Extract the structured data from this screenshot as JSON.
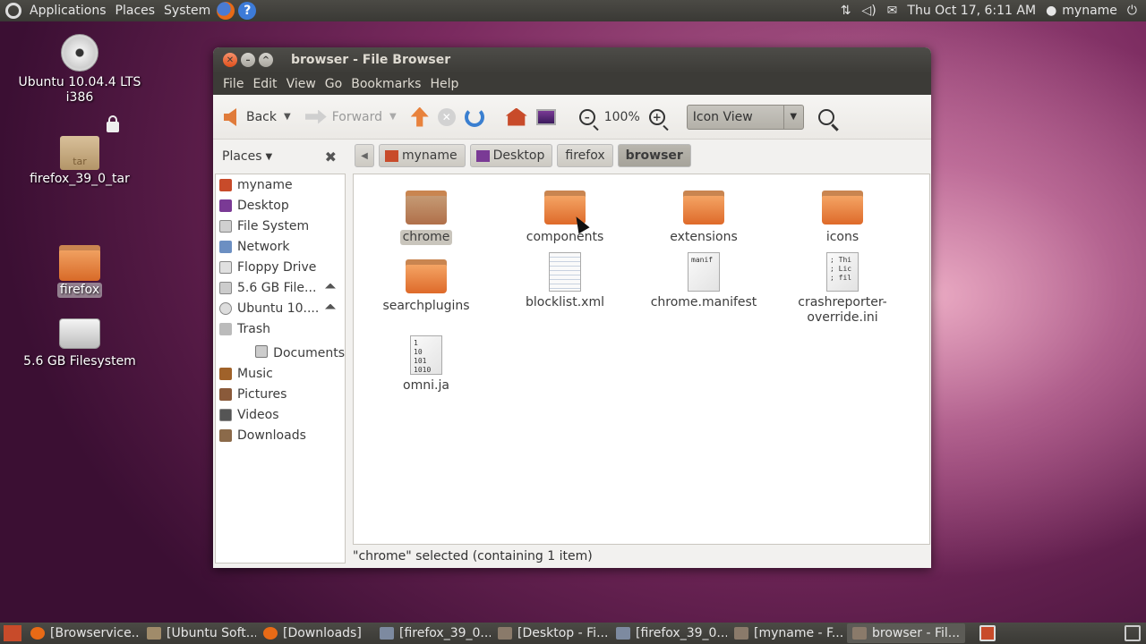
{
  "top_panel": {
    "menus": [
      "Applications",
      "Places",
      "System"
    ],
    "datetime": "Thu Oct 17,  6:11 AM",
    "user": "myname"
  },
  "desktop": {
    "icons": [
      {
        "label_line1": "Ubuntu 10.04.4 LTS",
        "label_line2": "i386"
      },
      {
        "label": "firefox_39_0_tar",
        "badge": "tar"
      },
      {
        "label": "firefox"
      },
      {
        "label": "5.6 GB Filesystem"
      }
    ]
  },
  "window": {
    "title": "browser - File Browser",
    "menu": [
      "File",
      "Edit",
      "View",
      "Go",
      "Bookmarks",
      "Help"
    ],
    "toolbar": {
      "back": "Back",
      "forward": "Forward",
      "zoom": "100%",
      "view_mode": "Icon View"
    },
    "sidebar": {
      "header": "Places",
      "items": [
        "myname",
        "Desktop",
        "File System",
        "Network",
        "Floppy Drive",
        "5.6 GB File...",
        "Ubuntu 10....",
        "Trash",
        "Documents",
        "Music",
        "Pictures",
        "Videos",
        "Downloads"
      ]
    },
    "path": [
      "myname",
      "Desktop",
      "firefox",
      "browser"
    ],
    "files": [
      {
        "name": "chrome",
        "type": "folder",
        "selected": true
      },
      {
        "name": "components",
        "type": "folder"
      },
      {
        "name": "extensions",
        "type": "folder"
      },
      {
        "name": "icons",
        "type": "folder"
      },
      {
        "name": "searchplugins",
        "type": "folder"
      },
      {
        "name": "blocklist.xml",
        "type": "xml"
      },
      {
        "name": "chrome.manifest",
        "type": "text",
        "preview": "manif"
      },
      {
        "name_line1": "crashreporter-",
        "name_line2": "override.ini",
        "type": "text",
        "preview": "; Thi\n; Lic\n; fil"
      },
      {
        "name": "omni.ja",
        "type": "binary",
        "preview": "1\n10\n101\n1010"
      }
    ],
    "status": "\"chrome\" selected (containing 1 item)"
  },
  "taskbar": {
    "tasks": [
      "[Browservice...",
      "[Ubuntu Soft...",
      "[Downloads]",
      "[firefox_39_0...",
      "[Desktop - Fi...",
      "[firefox_39_0...",
      "[myname - F...",
      "browser - Fil..."
    ]
  }
}
